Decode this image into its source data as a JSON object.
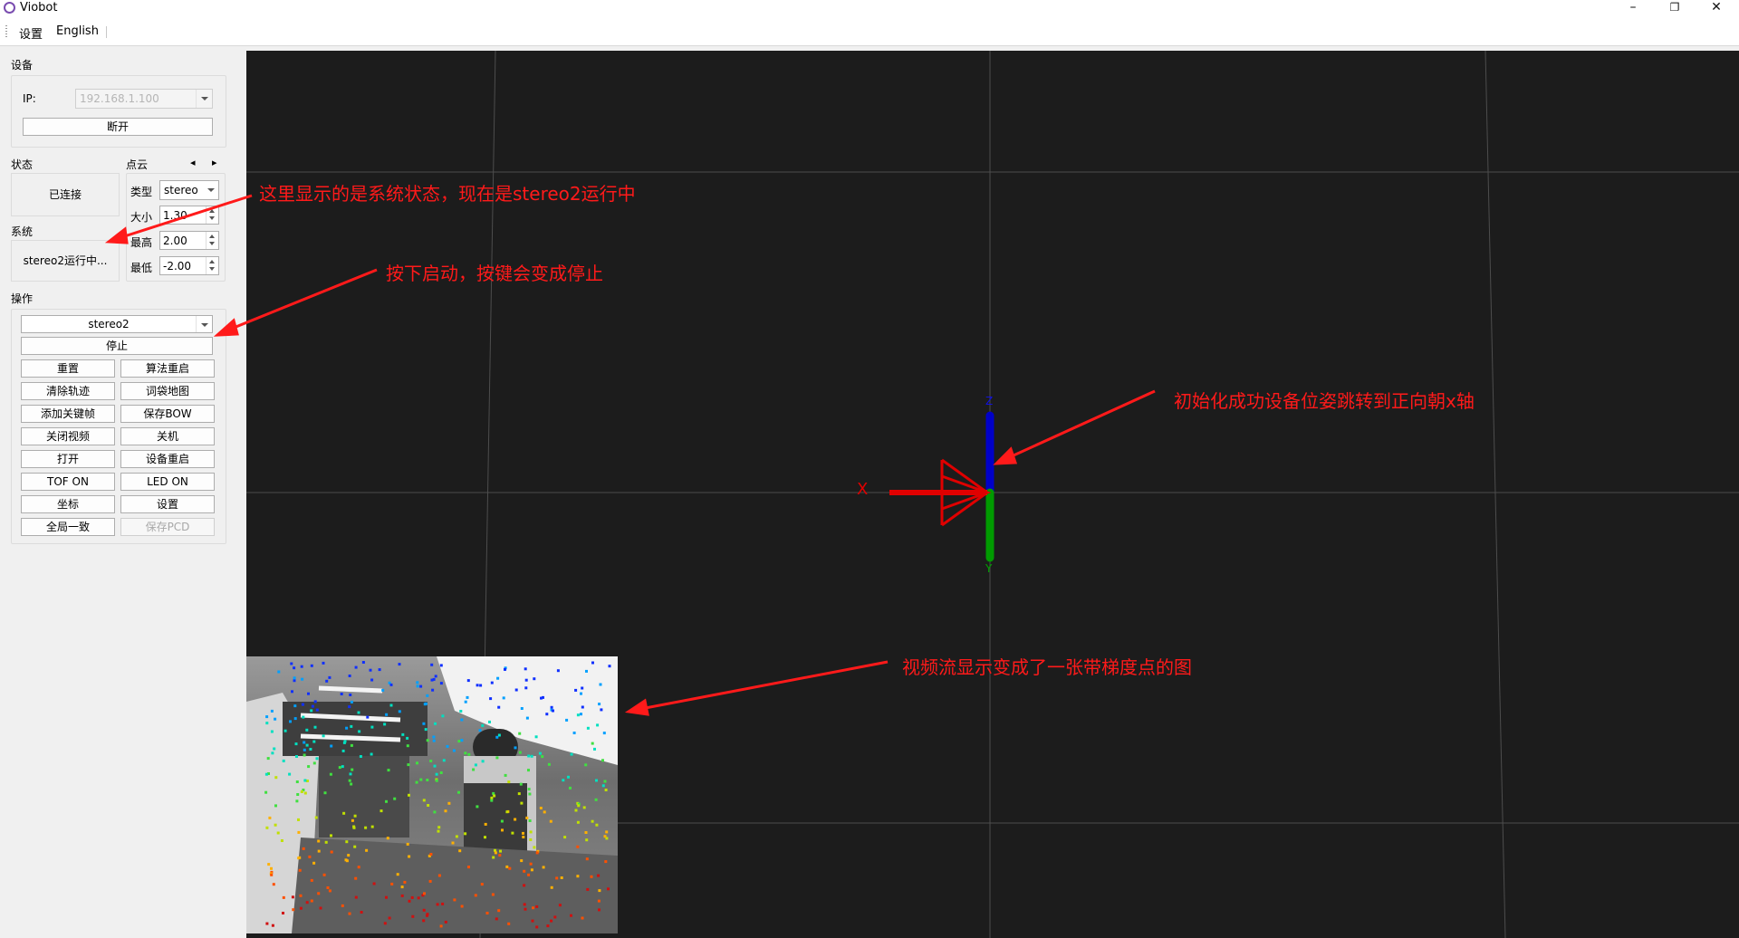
{
  "window": {
    "title": "Viobot",
    "minimize": "–",
    "maximize": "❐",
    "close": "✕"
  },
  "menu": {
    "items": [
      "设置",
      "English"
    ]
  },
  "device": {
    "group_title": "设备",
    "ip_label": "IP:",
    "ip_value": "192.168.1.100",
    "disconnect_button": "断开"
  },
  "state": {
    "title": "状态",
    "value": "已连接"
  },
  "system": {
    "title": "系统",
    "value": "stereo2运行中..."
  },
  "pointcloud": {
    "title": "点云",
    "prev_icon": "◂",
    "next_icon": "▸",
    "type_label": "类型",
    "type_value": "stereo",
    "size_label": "大小",
    "size_value": "1.30",
    "max_label": "最高",
    "max_value": "2.00",
    "min_label": "最低",
    "min_value": "-2.00"
  },
  "operations": {
    "title": "操作",
    "mode_value": "stereo2",
    "stop_button": "停止",
    "buttons": [
      [
        "重置",
        "算法重启"
      ],
      [
        "清除轨迹",
        "词袋地图"
      ],
      [
        "添加关键帧",
        "保存BOW"
      ],
      [
        "关闭视频",
        "关机"
      ],
      [
        "打开",
        "设备重启"
      ],
      [
        "TOF ON",
        "LED ON"
      ],
      [
        "坐标",
        "设置"
      ],
      [
        "全局一致",
        "保存PCD"
      ]
    ]
  },
  "viewer": {
    "x_axis_label": "X",
    "y_axis_label": "Y",
    "z_axis_label": "Z",
    "colors": {
      "background": "#1c1c1c",
      "grid": "#555555",
      "x_axis": "#ff0000",
      "y_axis": "#00a000",
      "z_axis": "#0000c8"
    }
  },
  "annotations": {
    "status_note": "这里显示的是系统状态，现在是stereo2运行中",
    "start_note": "按下启动，按键会变成停止",
    "init_note": "初始化成功设备位姿跳转到正向朝x轴",
    "video_note": "视频流显示变成了一张带梯度点的图",
    "color": "#ff1a1a"
  }
}
